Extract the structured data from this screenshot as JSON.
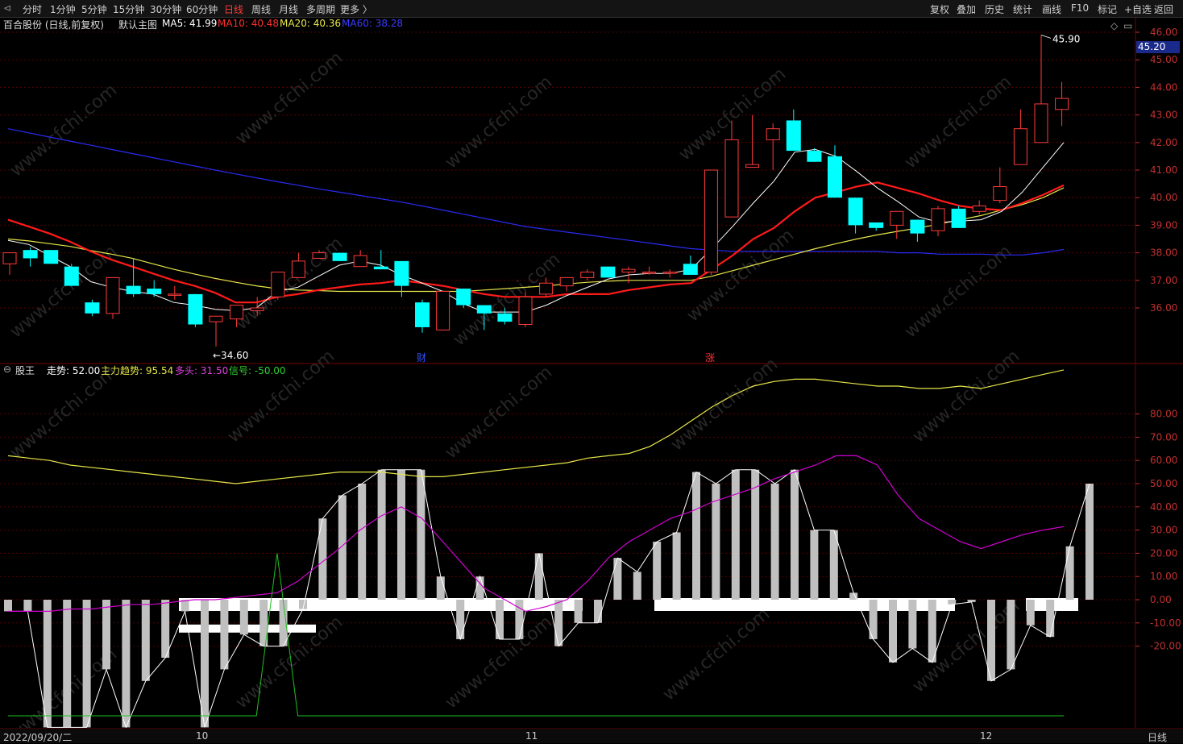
{
  "toolbar": {
    "periods": [
      "分时",
      "1分钟",
      "5分钟",
      "15分钟",
      "30分钟",
      "60分钟",
      "日线",
      "周线",
      "月线",
      "多周期",
      "更多 〉"
    ],
    "active_period": "日线",
    "right_buttons": [
      "复权",
      "叠加",
      "历史",
      "统计",
      "画线",
      "F10",
      "标记",
      "+自选",
      "返回"
    ]
  },
  "main_info": {
    "stock": "百合股份 (日线,前复权)",
    "template": "默认主图",
    "ma5": "MA5: 41.99",
    "ma10": "MA10: 40.48",
    "ma20": "MA20: 40.36",
    "ma60": "MA60: 38.28"
  },
  "sub_info": {
    "name": "股王",
    "zoushi": "走势: 52.00",
    "zhuli": "主力趋势: 95.54",
    "duotou": "多头: 31.50",
    "xinhao": "信号: -50.00"
  },
  "price_axis": [
    "46.00",
    "45.00",
    "44.00",
    "43.00",
    "42.00",
    "41.00",
    "40.00",
    "39.00",
    "38.00",
    "37.00",
    "36.00"
  ],
  "sub_axis": [
    "80.00",
    "70.00",
    "60.00",
    "50.00",
    "40.00",
    "30.00",
    "20.00",
    "10.00",
    "0.00",
    "-10.00",
    "-20.00"
  ],
  "current_price": "45.20",
  "high_label": "45.90",
  "low_label": "34.60",
  "event_markers": [
    "财",
    "涨"
  ],
  "date_labels": [
    "2022/09/20/二",
    "10",
    "11",
    "12"
  ],
  "status_right": "日线",
  "watermark": "www.cfchi.com",
  "colors": {
    "up": "#ff3b3b",
    "down": "#00ffff",
    "ma5": "#ffffff",
    "ma10": "#ff1a1a",
    "ma20": "#e6e64a",
    "ma60": "#2a2af5",
    "trend": "#e6e64a",
    "long": "#d000d0",
    "signal": "#20c020"
  },
  "chart_data": {
    "type": "candlestick",
    "candles": [
      [
        37.6,
        38.0,
        37.2,
        38.0
      ],
      [
        38.1,
        37.8,
        37.5,
        38.2
      ],
      [
        38.1,
        37.6,
        37.6,
        38.1
      ],
      [
        37.5,
        36.8,
        36.8,
        37.6
      ],
      [
        36.2,
        35.8,
        35.7,
        36.3
      ],
      [
        35.8,
        37.1,
        35.6,
        37.1
      ],
      [
        36.8,
        36.5,
        36.4,
        37.8
      ],
      [
        36.7,
        36.5,
        36.4,
        37.0
      ],
      [
        36.5,
        36.5,
        36.3,
        36.8
      ],
      [
        36.5,
        35.4,
        35.3,
        36.5
      ],
      [
        35.5,
        35.7,
        34.6,
        35.7
      ],
      [
        35.6,
        36.1,
        35.3,
        36.1
      ],
      [
        35.9,
        36.0,
        35.7,
        36.4
      ],
      [
        36.4,
        37.3,
        36.3,
        37.3
      ],
      [
        37.1,
        37.7,
        37.1,
        38.0
      ],
      [
        37.8,
        38.0,
        37.8,
        38.1
      ],
      [
        38.0,
        37.7,
        37.7,
        38.0
      ],
      [
        37.5,
        37.9,
        37.5,
        38.1
      ],
      [
        37.5,
        37.4,
        37.4,
        38.1
      ],
      [
        37.7,
        36.8,
        36.4,
        37.7
      ],
      [
        36.2,
        35.3,
        35.1,
        36.3
      ],
      [
        35.2,
        36.6,
        35.2,
        36.6
      ],
      [
        36.7,
        36.1,
        36.0,
        36.7
      ],
      [
        36.1,
        35.8,
        35.2,
        36.1
      ],
      [
        35.8,
        35.5,
        35.4,
        36.0
      ],
      [
        35.4,
        36.4,
        35.3,
        36.6
      ],
      [
        36.5,
        36.9,
        36.4,
        37.1
      ],
      [
        36.8,
        37.1,
        36.6,
        37.1
      ],
      [
        37.1,
        37.3,
        37.0,
        37.4
      ],
      [
        37.5,
        37.1,
        37.1,
        37.5
      ],
      [
        37.3,
        37.4,
        36.9,
        37.5
      ],
      [
        37.3,
        37.3,
        37.2,
        37.5
      ],
      [
        37.3,
        37.3,
        37.1,
        37.4
      ],
      [
        37.6,
        37.2,
        37.2,
        37.9
      ],
      [
        37.3,
        41.0,
        37.2,
        41.0
      ],
      [
        39.3,
        42.1,
        39.3,
        42.8
      ],
      [
        41.1,
        41.2,
        41.1,
        43.0
      ],
      [
        42.1,
        42.5,
        41.0,
        42.7
      ],
      [
        42.8,
        41.7,
        41.7,
        43.2
      ],
      [
        41.7,
        41.3,
        41.3,
        41.8
      ],
      [
        41.5,
        40.0,
        40.0,
        41.9
      ],
      [
        40.0,
        39.0,
        38.7,
        40.0
      ],
      [
        39.1,
        38.9,
        38.8,
        39.1
      ],
      [
        39.0,
        39.5,
        38.5,
        39.5
      ],
      [
        39.2,
        38.7,
        38.4,
        39.2
      ],
      [
        38.8,
        39.6,
        38.6,
        39.7
      ],
      [
        39.6,
        38.9,
        38.9,
        39.7
      ],
      [
        39.5,
        39.7,
        39.4,
        39.9
      ],
      [
        39.9,
        40.4,
        39.8,
        41.1
      ],
      [
        41.2,
        42.5,
        41.2,
        43.2
      ],
      [
        42.0,
        43.4,
        42.0,
        45.9
      ],
      [
        43.2,
        43.6,
        42.6,
        44.2
      ]
    ],
    "ma5": [
      38.45,
      38.3,
      37.9,
      37.5,
      36.95,
      36.75,
      36.6,
      36.5,
      36.2,
      36.1,
      35.95,
      35.9,
      36.0,
      36.6,
      36.75,
      37.15,
      37.55,
      37.7,
      37.55,
      37.2,
      36.9,
      36.6,
      36.15,
      35.85,
      35.85,
      35.85,
      36.1,
      36.45,
      36.75,
      37.05,
      37.2,
      37.25,
      37.25,
      37.4,
      38.15,
      38.95,
      39.8,
      40.6,
      41.65,
      41.75,
      41.5,
      40.95,
      40.35,
      39.85,
      39.3,
      39.1,
      39.15,
      39.2,
      39.5,
      40.2,
      41.1,
      42.0
    ],
    "ma10": [
      39.2,
      38.95,
      38.7,
      38.4,
      38.05,
      37.75,
      37.5,
      37.25,
      37.0,
      36.8,
      36.55,
      36.2,
      36.2,
      36.4,
      36.5,
      36.65,
      36.75,
      36.85,
      36.9,
      37.0,
      36.9,
      36.8,
      36.65,
      36.5,
      36.4,
      36.4,
      36.4,
      36.5,
      36.5,
      36.5,
      36.65,
      36.75,
      36.85,
      36.9,
      37.4,
      37.9,
      38.5,
      38.9,
      39.5,
      40.0,
      40.2,
      40.4,
      40.55,
      40.35,
      40.15,
      39.9,
      39.7,
      39.6,
      39.55,
      39.8,
      40.1,
      40.45
    ],
    "ma20": [
      38.5,
      38.43,
      38.33,
      38.23,
      38.08,
      37.95,
      37.8,
      37.6,
      37.4,
      37.23,
      37.07,
      36.93,
      36.8,
      36.7,
      36.65,
      36.63,
      36.6,
      36.6,
      36.6,
      36.6,
      36.6,
      36.6,
      36.6,
      36.65,
      36.7,
      36.75,
      36.8,
      36.87,
      36.93,
      36.97,
      37.0,
      37.0,
      37.0,
      37.0,
      37.15,
      37.35,
      37.55,
      37.75,
      37.95,
      38.15,
      38.33,
      38.5,
      38.65,
      38.78,
      38.9,
      39.05,
      39.2,
      39.35,
      39.55,
      39.75,
      40.0,
      40.36
    ],
    "ma60": [
      42.5,
      42.35,
      42.2,
      42.05,
      41.9,
      41.75,
      41.6,
      41.45,
      41.3,
      41.15,
      41.0,
      40.86,
      40.72,
      40.58,
      40.45,
      40.32,
      40.2,
      40.08,
      39.96,
      39.84,
      39.7,
      39.55,
      39.4,
      39.25,
      39.1,
      38.95,
      38.85,
      38.75,
      38.65,
      38.55,
      38.45,
      38.35,
      38.25,
      38.15,
      38.1,
      38.05,
      38.05,
      38.05,
      38.05,
      38.05,
      38.05,
      38.05,
      38.05,
      38.0,
      38.0,
      37.95,
      37.95,
      37.95,
      37.92,
      37.92,
      38.0,
      38.12
    ],
    "zoushi": [
      -5,
      -5,
      -55,
      -55,
      -55,
      -30,
      -55,
      -35,
      -25,
      -5,
      -55,
      -30,
      -15,
      -20,
      -20,
      -4,
      35,
      45,
      50,
      56,
      56,
      56,
      10,
      -17,
      10,
      -17,
      -17,
      20,
      -20,
      -10,
      -10,
      18,
      12,
      25,
      29,
      55,
      50,
      56,
      56,
      50,
      56,
      30,
      30,
      3,
      -17,
      -27,
      -21,
      -27,
      -2,
      -1,
      -35,
      -30,
      -11,
      -16,
      23,
      50
    ],
    "trend": [
      62,
      61,
      60,
      58,
      57,
      56,
      55,
      54,
      53,
      52,
      51,
      50,
      51,
      52,
      53,
      54,
      55,
      55,
      55,
      54,
      53,
      53,
      54,
      55,
      56,
      57,
      58,
      59,
      61,
      62,
      63,
      66,
      71,
      77,
      83,
      88,
      92,
      94,
      95,
      95,
      94,
      93,
      92,
      92,
      91,
      91,
      92,
      91,
      93,
      95,
      97,
      99
    ],
    "duotou": [
      -5,
      -5,
      -5,
      -4,
      -4,
      -3,
      -2,
      -2,
      -1,
      0,
      0,
      1,
      2,
      3,
      8,
      15,
      22,
      30,
      36,
      40,
      35,
      25,
      15,
      5,
      0,
      -5,
      -3,
      0,
      8,
      18,
      25,
      30,
      35,
      38,
      42,
      45,
      48,
      52,
      55,
      58,
      62,
      62,
      58,
      45,
      35,
      30,
      25,
      22,
      25,
      28,
      30,
      31.5
    ],
    "xinhao": [
      -50,
      -50,
      -50,
      -50,
      -50,
      -50,
      -50,
      -50,
      -50,
      -50,
      -50,
      -50,
      -50,
      20,
      -50,
      -50,
      -50,
      -50,
      -50,
      -50,
      -50,
      -50,
      -50,
      -50,
      -50,
      -50,
      -50,
      -50,
      -50,
      -50,
      -50,
      -50,
      -50,
      -50,
      -50,
      -50,
      -50,
      -50,
      -50,
      -50,
      -50,
      -50,
      -50,
      -50,
      -50,
      -50,
      -50,
      -50,
      -50,
      -50,
      -50,
      -50
    ]
  }
}
